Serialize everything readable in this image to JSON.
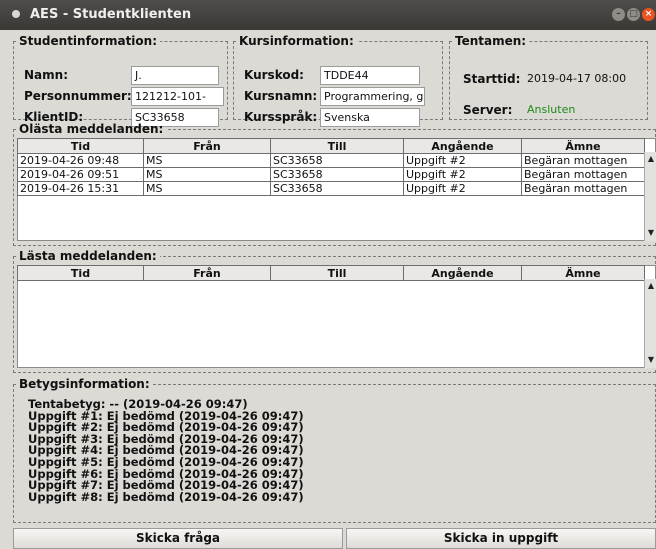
{
  "window": {
    "title": "AES - Studentklienten"
  },
  "student": {
    "legend": "Studentinformation:",
    "name_label": "Namn:",
    "name_value": "J.",
    "pnr_label": "Personnummer:",
    "pnr_value": "121212-101-",
    "client_label": "KlientID:",
    "client_value": "SC33658"
  },
  "course": {
    "legend": "Kursinformation:",
    "code_label": "Kurskod:",
    "code_value": "TDDE44",
    "name_label": "Kursnamn:",
    "name_value": "Programmering, gr",
    "lang_label": "Kursspråk:",
    "lang_value": "Svenska"
  },
  "exam": {
    "legend": "Tentamen:",
    "start_label": "Starttid:",
    "start_value": "2019-04-17 08:00",
    "server_label": "Server:",
    "server_value": "Ansluten",
    "server_color": "#1b8a1b"
  },
  "unread": {
    "legend": "Olästa meddelanden:",
    "columns": [
      "Tid",
      "Från",
      "Till",
      "Angående",
      "Ämne"
    ],
    "rows": [
      [
        "2019-04-26 09:48",
        "MS",
        "SC33658",
        "Uppgift #2",
        "Begäran mottagen"
      ],
      [
        "2019-04-26 09:51",
        "MS",
        "SC33658",
        "Uppgift #2",
        "Begäran mottagen"
      ],
      [
        "2019-04-26 15:31",
        "MS",
        "SC33658",
        "Uppgift #2",
        "Begäran mottagen"
      ]
    ]
  },
  "read": {
    "legend": "Lästa meddelanden:",
    "columns": [
      "Tid",
      "Från",
      "Till",
      "Angående",
      "Ämne"
    ]
  },
  "grades": {
    "legend": "Betygsinformation:",
    "lines": [
      "Tentabetyg: -- (2019-04-26 09:47)",
      "Uppgift #1: Ej bedömd (2019-04-26 09:47)",
      "Uppgift #2: Ej bedömd (2019-04-26 09:47)",
      "Uppgift #3: Ej bedömd (2019-04-26 09:47)",
      "Uppgift #4: Ej bedömd (2019-04-26 09:47)",
      "Uppgift #5: Ej bedömd (2019-04-26 09:47)",
      "Uppgift #6: Ej bedömd (2019-04-26 09:47)",
      "Uppgift #7: Ej bedömd (2019-04-26 09:47)",
      "Uppgift #8: Ej bedömd (2019-04-26 09:47)"
    ]
  },
  "buttons": {
    "ask": "Skicka fråga",
    "submit": "Skicka in uppgift"
  },
  "icons": {
    "scroll_up": "▲",
    "scroll_down": "▼",
    "minimize": "–",
    "maximize": "□",
    "close": "×"
  }
}
